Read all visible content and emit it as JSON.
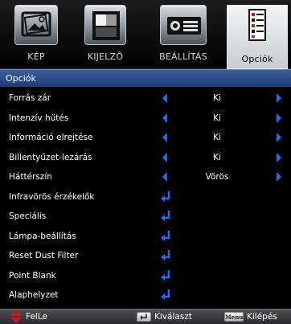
{
  "tabs": [
    {
      "label": "KÉP",
      "icon": "picture-icon",
      "active": false
    },
    {
      "label": "KIJELZŐ",
      "icon": "display-icon",
      "active": false
    },
    {
      "label": "BEÁLLÍTÁS",
      "icon": "projector-icon",
      "active": false
    },
    {
      "label": "Opciók",
      "icon": "options-list-icon",
      "active": true
    }
  ],
  "section": {
    "title": "Opciók"
  },
  "rows": [
    {
      "label": "Forrás zár",
      "value": "Ki",
      "type": "select"
    },
    {
      "label": "Intenzív hűtés",
      "value": "Ki",
      "type": "select"
    },
    {
      "label": "Információ elrejtése",
      "value": "Ki",
      "type": "select"
    },
    {
      "label": "Billentyűzet-lezárás",
      "value": "Ki",
      "type": "select"
    },
    {
      "label": "Háttérszín",
      "value": "Vörös",
      "type": "select"
    },
    {
      "label": "Infravörös érzékelők",
      "type": "submenu"
    },
    {
      "label": "Speciális",
      "type": "submenu"
    },
    {
      "label": "Lámpa-beállítás",
      "type": "submenu"
    },
    {
      "label": "Reset Dust Filter",
      "type": "submenu"
    },
    {
      "label": "Point Blank",
      "type": "submenu"
    },
    {
      "label": "Alaphelyzet",
      "type": "submenu"
    }
  ],
  "bottom": {
    "updown_label": "FelLe",
    "select_label": "Kiválaszt",
    "menu_key": "Menu",
    "exit_label": "Kilépés"
  },
  "colors": {
    "accent_blue": "#1e6cf0",
    "header_blue": "#2b4c88",
    "updown_red": "#d4141e"
  }
}
